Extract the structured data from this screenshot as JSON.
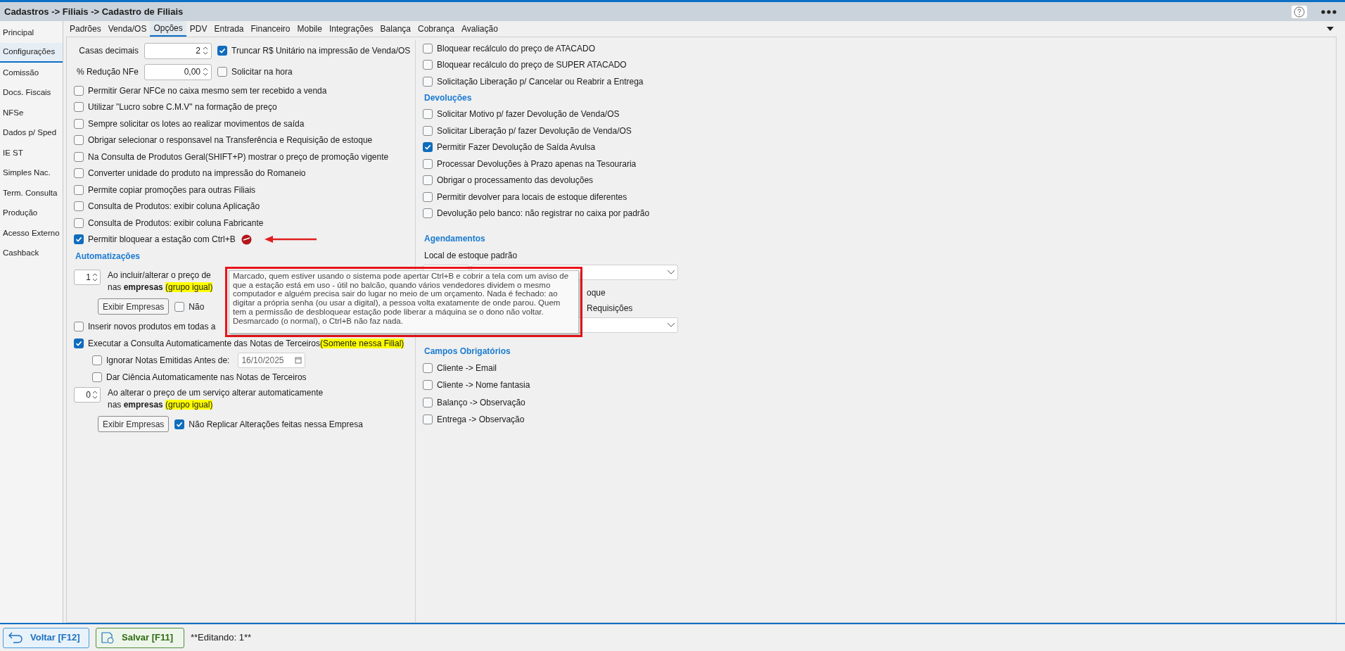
{
  "breadcrumb": "Cadastros -> Filiais -> Cadastro de Filiais",
  "sidebar": [
    {
      "label": "Principal",
      "selected": false
    },
    {
      "label": "Configurações",
      "selected": true
    },
    {
      "label": "Comissão",
      "selected": false
    },
    {
      "label": "Docs. Fiscais",
      "selected": false
    },
    {
      "label": "NFSe",
      "selected": false
    },
    {
      "label": "Dados p/ Sped",
      "selected": false
    },
    {
      "label": "IE ST",
      "selected": false
    },
    {
      "label": "Simples Nac.",
      "selected": false
    },
    {
      "label": "Term. Consulta",
      "selected": false
    },
    {
      "label": "Produção",
      "selected": false
    },
    {
      "label": "Acesso Externo",
      "selected": false
    },
    {
      "label": "Cashback",
      "selected": false
    }
  ],
  "tabs": [
    {
      "label": "Padrões",
      "selected": false
    },
    {
      "label": "Venda/OS",
      "selected": false
    },
    {
      "label": "Opções",
      "selected": true
    },
    {
      "label": "PDV",
      "selected": false
    },
    {
      "label": "Entrada",
      "selected": false
    },
    {
      "label": "Financeiro",
      "selected": false
    },
    {
      "label": "Mobile",
      "selected": false
    },
    {
      "label": "Integrações",
      "selected": false
    },
    {
      "label": "Balança",
      "selected": false
    },
    {
      "label": "Cobrança",
      "selected": false
    },
    {
      "label": "Avaliação",
      "selected": false
    }
  ],
  "left": {
    "decimal": {
      "label": "Casas decimais",
      "value": "2"
    },
    "truncate": {
      "label": "Truncar R$ Unitário na impressão de Venda/OS",
      "checked": true
    },
    "reduction": {
      "label": "% Redução NFe",
      "value": "0,00"
    },
    "ask_now": {
      "label": "Solicitar na hora",
      "checked": false
    },
    "options": [
      {
        "label": "Permitir Gerar NFCe no caixa mesmo sem ter recebido a venda",
        "checked": false
      },
      {
        "label": "Utilizar \"Lucro sobre C.M.V\" na formação de preço",
        "checked": false
      },
      {
        "label": "Sempre solicitar os lotes ao realizar movimentos de saída",
        "checked": false
      },
      {
        "label": "Obrigar selecionar o responsavel na Transferência e Requisição de estoque",
        "checked": false
      },
      {
        "label": "Na Consulta de Produtos Geral(SHIFT+P) mostrar o preço de promoção vigente",
        "checked": false
      },
      {
        "label": "Converter unidade do produto na impressão do Romaneio",
        "checked": false
      },
      {
        "label": "Permite copiar promoções para outras Filiais",
        "checked": false
      },
      {
        "label": "Consulta de Produtos: exibir coluna Aplicação",
        "checked": false
      },
      {
        "label": "Consulta de Produtos: exibir coluna Fabricante",
        "checked": false
      },
      {
        "label": "Permitir bloquear a estação com Ctrl+B",
        "checked": true,
        "kind": "new"
      }
    ],
    "automations": {
      "title": "Automatizações",
      "product_rule": {
        "qty": "1",
        "line1": "Ao incluir/alterar o preço de",
        "line2": "nas **empresas**",
        "highlight": "(grupo igual)",
        "button": "Exibir Empresas",
        "option": {
          "label": "Não",
          "checked": false
        }
      },
      "insert_all": {
        "label": "Inserir novos produtos em todas a",
        "checked": false
      },
      "auto_query": {
        "label": "Executar a Consulta Automaticamente das Notas de Terceiros",
        "highlight": "(Somente nessa Filial)",
        "checked": true
      },
      "ignore_before": {
        "label": "Ignorar Notas Emitidas Antes de:",
        "checked": false,
        "date": "16/10/2025"
      },
      "acknowledge": {
        "label": "Dar Ciência Automaticamente nas Notas de Terceiros",
        "checked": false
      },
      "service_rule": {
        "qty": "0",
        "line1": "Ao alterar o preço de um serviço alterar automaticamente",
        "line2": "nas **empresas**",
        "highlight": "(grupo igual)",
        "button": "Exibir Empresas",
        "option": {
          "label": "Não Replicar Alterações feitas nessa Empresa",
          "checked": true
        }
      }
    }
  },
  "right": {
    "options": [
      {
        "label": "Bloquear recálculo do preço de ATACADO",
        "checked": false
      },
      {
        "label": "Bloquear recálculo do preço de SUPER ATACADO",
        "checked": false
      },
      {
        "label": "Solicitação Liberação p/ Cancelar ou Reabrir a Entrega",
        "checked": false
      }
    ],
    "returns": {
      "title": "Devoluções",
      "options": [
        {
          "label": "Solicitar Motivo p/ fazer Devolução de Venda/OS",
          "checked": false
        },
        {
          "label": "Solicitar Liberação p/ fazer Devolução de Venda/OS",
          "checked": false
        },
        {
          "label": "Permitir Fazer Devolução de Saída Avulsa",
          "checked": true
        },
        {
          "label": "Processar Devoluções à Prazo apenas na Tesouraria",
          "checked": false
        },
        {
          "label": "Obrigar o processamento das devoluções",
          "checked": false
        },
        {
          "label": "Permitir devolver para locais de estoque diferentes",
          "checked": false
        },
        {
          "label": "Devolução pelo banco: não registrar no caixa por padrão",
          "checked": false
        }
      ]
    },
    "schedules": {
      "title": "Agendamentos",
      "stock_label": "Local de estoque padrão",
      "label_2": "oque",
      "label_3": "Requisições"
    },
    "required": {
      "title": "Campos Obrigatórios",
      "options": [
        {
          "label": "Cliente -> Email",
          "checked": false
        },
        {
          "label": "Cliente -> Nome fantasia",
          "checked": false
        },
        {
          "label": "Balanço -> Observação",
          "checked": false
        },
        {
          "label": "Entrega -> Observação",
          "checked": false
        }
      ]
    }
  },
  "tooltip": "Marcado, quem estiver usando o sistema pode apertar Ctrl+B e cobrir a tela com um aviso de que a estação está em uso - útil no balcão, quando vários vendedores dividem o mesmo computador e alguém precisa sair do lugar no meio de um orçamento. Nada é fechado: ao digitar a própria senha (ou usar a digital), a pessoa volta exatamente de onde parou. Quem tem a permissão de desbloquear estação pode liberar a máquina se o dono não voltar. Desmarcado (o normal), o Ctrl+B não faz nada.",
  "footer": {
    "back": "Voltar [F12]",
    "save": "Salvar [F11]",
    "status": "**Editando: 1**"
  }
}
